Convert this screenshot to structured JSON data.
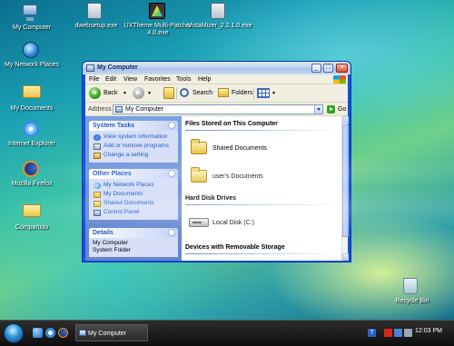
{
  "desktop": {
    "icons": [
      {
        "label": "My Computer"
      },
      {
        "label": "dwebsetup.exe"
      },
      {
        "label": "UXTheme Multi-Patcher 4.0.exe"
      },
      {
        "label": "VistaMizer_2.2.1.0.exe"
      },
      {
        "label": "My Network Places"
      },
      {
        "label": "My Documents"
      },
      {
        "label": "Internet Explorer"
      },
      {
        "label": "Mozilla Firefox"
      },
      {
        "label": "Compartido"
      },
      {
        "label": "Recycle Bin"
      }
    ]
  },
  "window": {
    "title": "My Computer",
    "controls": {
      "minimize": "_",
      "maximize": "□",
      "close": "✕"
    },
    "menu": [
      "File",
      "Edit",
      "View",
      "Favorites",
      "Tools",
      "Help"
    ],
    "toolbar": {
      "back": "Back",
      "search": "Search",
      "folders": "Folders"
    },
    "address": {
      "label": "Address",
      "value": "My Computer",
      "go": "Go"
    },
    "left_pane": {
      "system_tasks": {
        "title": "System Tasks",
        "items": [
          "View system information",
          "Add or remove programs",
          "Change a setting"
        ]
      },
      "other_places": {
        "title": "Other Places",
        "items": [
          "My Network Places",
          "My Documents",
          "Shared Documents",
          "Control Panel"
        ]
      },
      "details": {
        "title": "Details",
        "line1": "My Computer",
        "line2": "System Folder"
      }
    },
    "main": {
      "sections": {
        "files": "Files Stored on This Computer",
        "disks": "Hard Disk Drives",
        "removable": "Devices with Removable Storage"
      },
      "items": {
        "shared_docs": "Shared Documents",
        "user_docs": "user's Documents",
        "local_disk": "Local Disk (C:)"
      }
    }
  },
  "taskbar": {
    "task_label": "My Computer",
    "clock": "12:03 PM"
  }
}
